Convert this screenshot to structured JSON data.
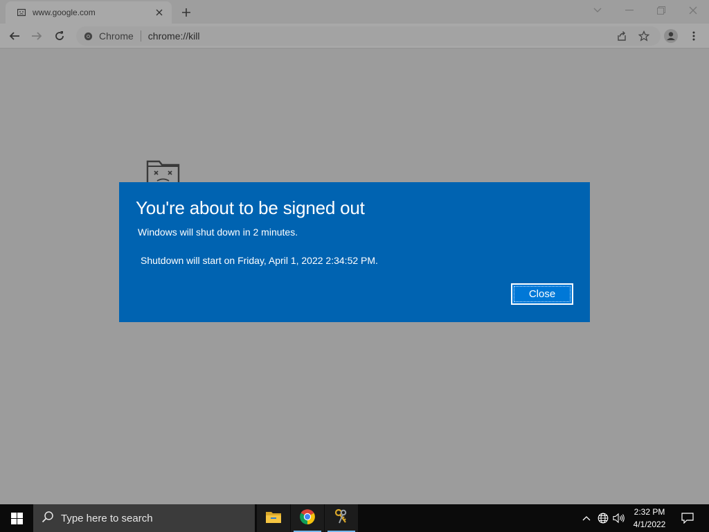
{
  "browser": {
    "tab": {
      "title": "www.google.com"
    },
    "omnibox": {
      "site": "Chrome",
      "url": "chrome://kill"
    }
  },
  "dialog": {
    "title": "You're about to be signed out",
    "message": "Windows will shut down in 2 minutes.",
    "detail": "Shutdown will start on Friday, April 1, 2022 2:34:52 PM.",
    "close_label": "Close",
    "background_color": "#0063b1"
  },
  "taskbar": {
    "search_placeholder": "Type here to search",
    "apps": [
      "file-explorer-icon",
      "chrome-icon",
      "keys-app-icon"
    ],
    "clock": {
      "time": "2:32 PM",
      "date": "4/1/2022"
    }
  }
}
